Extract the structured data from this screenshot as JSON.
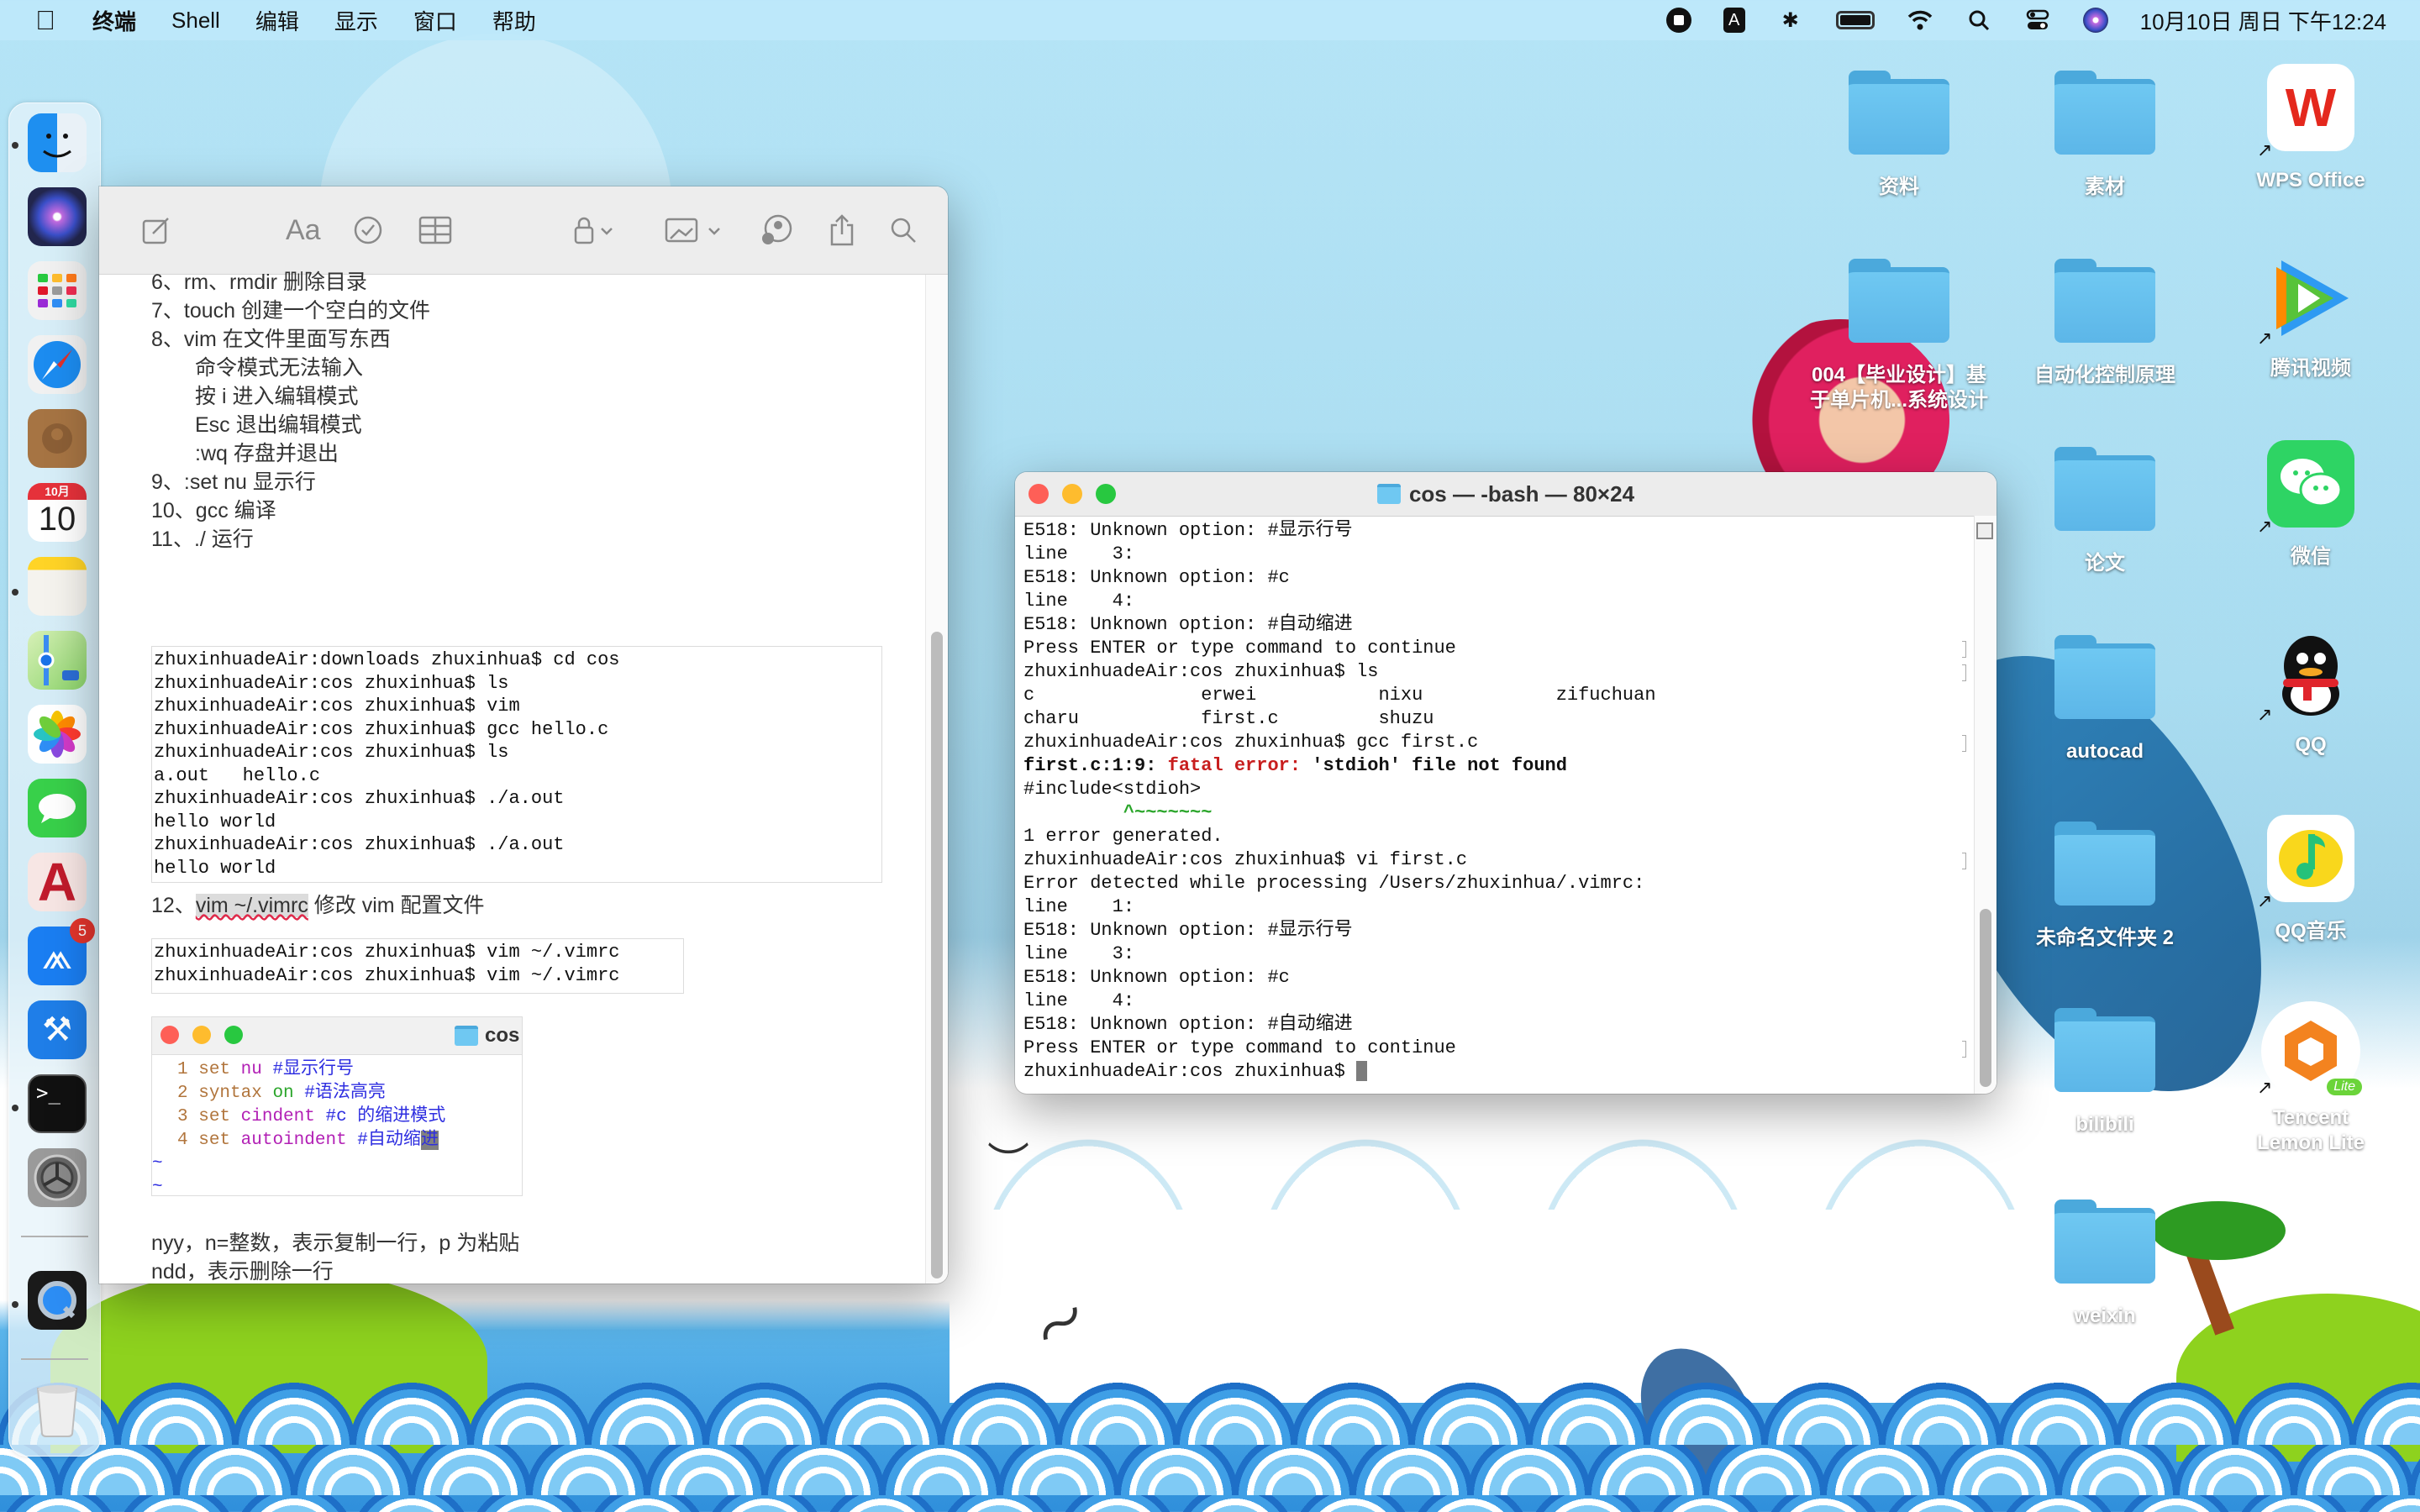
{
  "menubar": {
    "app_name": "终端",
    "items": [
      "Shell",
      "编辑",
      "显示",
      "窗口",
      "帮助"
    ],
    "status_icons": [
      "screen-record-icon",
      "input-method-icon",
      "bluetooth-icon",
      "battery-icon",
      "wifi-icon",
      "spotlight-search-icon",
      "control-center-icon",
      "siri-icon"
    ],
    "input_method_label": "A",
    "clock": "10月10日 周日 下午12:24"
  },
  "dock": {
    "items": [
      {
        "name": "Finder",
        "icon": "finder-icon",
        "running": true
      },
      {
        "name": "Siri",
        "icon": "siri-icon",
        "running": false
      },
      {
        "name": "Launchpad",
        "icon": "launchpad-icon",
        "running": false
      },
      {
        "name": "Safari",
        "icon": "safari-icon",
        "running": false
      },
      {
        "name": "Contacts",
        "icon": "contacts-icon",
        "running": false
      },
      {
        "name": "Calendar",
        "icon": "calendar-icon",
        "running": false,
        "month": "10月",
        "day": "10"
      },
      {
        "name": "Notes",
        "icon": "notes-icon",
        "running": true
      },
      {
        "name": "Maps",
        "icon": "maps-icon",
        "running": false
      },
      {
        "name": "Photos",
        "icon": "photos-icon",
        "running": false
      },
      {
        "name": "Messages",
        "icon": "messages-icon",
        "running": false
      },
      {
        "name": "AutoCAD",
        "icon": "autocad-icon",
        "running": false
      },
      {
        "name": "App Store",
        "icon": "app-store-icon",
        "running": false,
        "badge": "5"
      },
      {
        "name": "Xcode",
        "icon": "xcode-icon",
        "running": false
      },
      {
        "name": "Terminal",
        "icon": "terminal-icon",
        "running": true
      },
      {
        "name": "System Preferences",
        "icon": "system-preferences-icon",
        "running": false
      },
      {
        "name": "QuickTime Player",
        "icon": "quicktime-icon",
        "running": true
      },
      {
        "name": "Trash",
        "icon": "trash-icon",
        "running": false
      }
    ]
  },
  "desktop": {
    "icons": [
      {
        "label": "资料",
        "type": "folder"
      },
      {
        "label": "素材",
        "type": "folder"
      },
      {
        "label": "WPS Office",
        "type": "app-alias"
      },
      {
        "label": "004【毕业设计】基于单片机...系统设计",
        "type": "folder"
      },
      {
        "label": "自动化控制原理",
        "type": "folder"
      },
      {
        "label": "腾讯视频",
        "type": "app-alias"
      },
      {
        "label": "论文",
        "type": "folder"
      },
      {
        "label": "微信",
        "type": "app-alias"
      },
      {
        "label": "autocad",
        "type": "folder"
      },
      {
        "label": "QQ",
        "type": "app-alias"
      },
      {
        "label": "未命名文件夹 2",
        "type": "folder"
      },
      {
        "label": "QQ音乐",
        "type": "app-alias"
      },
      {
        "label": "bilibili",
        "type": "folder"
      },
      {
        "label": "Tencent Lemon Lite",
        "type": "app-alias",
        "badge": "Lite"
      },
      {
        "label": "weixin",
        "type": "folder"
      }
    ]
  },
  "notes": {
    "toolbar": [
      "compose-icon",
      "format-text-icon",
      "checklist-icon",
      "table-icon",
      "lock-icon",
      "media-icon",
      "collaborate-icon",
      "share-icon",
      "search-icon"
    ],
    "format_label": "Aa",
    "lines": [
      {
        "text": "6、rm、rmdir 删除目录",
        "indent": false
      },
      {
        "text": "7、touch 创建一个空白的文件",
        "indent": false
      },
      {
        "text": "8、vim 在文件里面写东西",
        "indent": false
      },
      {
        "text": "命令模式无法输入",
        "indent": true
      },
      {
        "text": "按 i 进入编辑模式",
        "indent": true
      },
      {
        "text": "Esc 退出编辑模式",
        "indent": true
      },
      {
        "text": ":wq 存盘并退出",
        "indent": true
      },
      {
        "text": "9、:set nu 显示行",
        "indent": false
      },
      {
        "text": "10、gcc 编译",
        "indent": false
      },
      {
        "text": "11、./ 运行",
        "indent": false
      }
    ],
    "code_block_1": [
      "zhuxinhuadeAir:downloads zhuxinhua$ cd cos",
      "zhuxinhuadeAir:cos zhuxinhua$ ls",
      "zhuxinhuadeAir:cos zhuxinhua$ vim",
      "zhuxinhuadeAir:cos zhuxinhua$ gcc hello.c",
      "zhuxinhuadeAir:cos zhuxinhua$ ls",
      "a.out   hello.c",
      "zhuxinhuadeAir:cos zhuxinhua$ ./a.out",
      "hello world",
      "zhuxinhuadeAir:cos zhuxinhua$ ./a.out",
      "hello world"
    ],
    "item12_prefix": "12、",
    "item12_highlight": "vim ~/.vimrc",
    "item12_suffix": " 修改 vim 配置文件",
    "code_block_2": [
      "zhuxinhuadeAir:cos zhuxinhua$ vim ~/.vimrc",
      "zhuxinhuadeAir:cos zhuxinhua$ vim ~/.vimrc"
    ],
    "vim_screenshot": {
      "title": "cos",
      "lines": [
        {
          "num": "1",
          "cmd": "set",
          "opt": "nu",
          "comment": "#显示行号"
        },
        {
          "num": "2",
          "cmd": "syntax",
          "opt": "on",
          "comment": "#语法高亮"
        },
        {
          "num": "3",
          "cmd": "set",
          "opt": "cindent",
          "comment": "#c 的缩进模式"
        },
        {
          "num": "4",
          "cmd": "set",
          "opt": "autoindent",
          "comment": "#自动缩",
          "cursor_char": "进"
        }
      ],
      "tilde": "~"
    },
    "footer_lines": [
      "nyy，n=整数，表示复制一行，p 为粘贴",
      "ndd，表示删除一行"
    ]
  },
  "terminal": {
    "title": "cos — -bash — 80×24",
    "lines": [
      {
        "text": "E518: Unknown option: #显示行号"
      },
      {
        "text": "line    3:"
      },
      {
        "text": "E518: Unknown option: #c"
      },
      {
        "text": "line    4:"
      },
      {
        "text": "E518: Unknown option: #自动缩进"
      },
      {
        "text": "Press ENTER or type command to continue",
        "mark": true
      },
      {
        "text": "zhuxinhuadeAir:cos zhuxinhua$ ls",
        "mark": true
      },
      {
        "text": "c               erwei           nixu            zifuchuan"
      },
      {
        "text": "charu           first.c         shuzu"
      },
      {
        "text": "zhuxinhuadeAir:cos zhuxinhua$ gcc first.c",
        "mark": true
      },
      {
        "type": "error",
        "prefix": "first.c:1:9: ",
        "label": "fatal error:",
        "message": " 'stdioh' file not found"
      },
      {
        "text": "#include<stdioh>"
      },
      {
        "type": "caret",
        "text": "         ^~~~~~~~"
      },
      {
        "text": "1 error generated."
      },
      {
        "text": "zhuxinhuadeAir:cos zhuxinhua$ vi first.c",
        "mark": true
      },
      {
        "text": "Error detected while processing /Users/zhuxinhua/.vimrc:"
      },
      {
        "text": "line    1:"
      },
      {
        "text": "E518: Unknown option: #显示行号"
      },
      {
        "text": "line    3:"
      },
      {
        "text": "E518: Unknown option: #c"
      },
      {
        "text": "line    4:"
      },
      {
        "text": "E518: Unknown option: #自动缩进"
      },
      {
        "text": "Press ENTER or type command to continue",
        "mark": true
      },
      {
        "type": "prompt",
        "text": "zhuxinhuadeAir:cos zhuxinhua$ "
      }
    ]
  },
  "colors": {
    "close": "#fe5f57",
    "minimize": "#febc2e",
    "zoom": "#28c840",
    "error_red": "#c81e1e",
    "caret_green": "#2aa52a"
  }
}
